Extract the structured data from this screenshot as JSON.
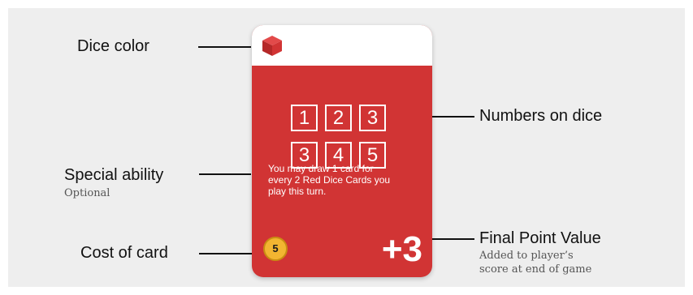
{
  "labels": {
    "dice_color": "Dice color",
    "numbers_on_dice": "Numbers on dice",
    "special_ability": "Special ability",
    "special_ability_note": "Optional",
    "cost_of_card": "Cost of card",
    "final_point_value": "Final Point Value",
    "final_point_value_note_line1": "Added to player’s",
    "final_point_value_note_line2": "score at end of game"
  },
  "card": {
    "dice_color": "red",
    "dice_color_hex": "#d13434",
    "dice_icon": "cube-icon",
    "numbers": [
      "1",
      "2",
      "3",
      "3",
      "4",
      "5"
    ],
    "ability_line1": "You may draw 1 card for",
    "ability_line2": "every 2 Red Dice Cards you",
    "ability_line3": "play this turn.",
    "cost": "5",
    "points": "+3"
  },
  "colors": {
    "card_red": "#d13434",
    "coin_gold": "#f2b531",
    "panel_gray": "#eeeeee"
  }
}
